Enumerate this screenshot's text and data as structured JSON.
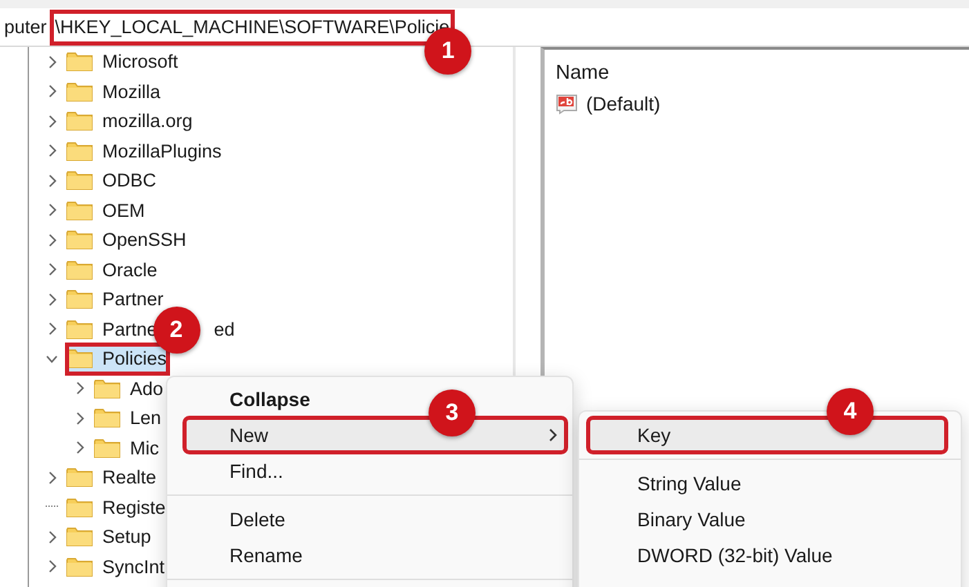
{
  "address_bar": {
    "segments": [
      {
        "text": "puter"
      },
      {
        "text": "\\HKEY_LOCAL_MACHINE\\SOFTWARE\\Policie",
        "step": "1"
      }
    ]
  },
  "tree": [
    {
      "label": "Microsoft",
      "has_children": true,
      "expanded": false,
      "selected": false
    },
    {
      "label": "Mozilla",
      "has_children": true,
      "expanded": false,
      "selected": false
    },
    {
      "label": "mozilla.org",
      "has_children": true,
      "expanded": false,
      "selected": false
    },
    {
      "label": "MozillaPlugins",
      "has_children": true,
      "expanded": false,
      "selected": false
    },
    {
      "label": "ODBC",
      "has_children": true,
      "expanded": false,
      "selected": false
    },
    {
      "label": "OEM",
      "has_children": true,
      "expanded": false,
      "selected": false
    },
    {
      "label": "OpenSSH",
      "has_children": true,
      "expanded": false,
      "selected": false
    },
    {
      "label": "Oracle",
      "has_children": true,
      "expanded": false,
      "selected": false
    },
    {
      "label": "Partner",
      "has_children": true,
      "expanded": false,
      "selected": false
    },
    {
      "label": "Partne",
      "label_tail": "ed",
      "has_children": true,
      "expanded": false,
      "selected": false
    },
    {
      "label": "Policies",
      "has_children": true,
      "expanded": true,
      "selected": true,
      "step": "2",
      "children": [
        {
          "label": "Ado",
          "has_children": true,
          "expanded": false,
          "selected": false
        },
        {
          "label": "Len",
          "has_children": true,
          "expanded": false,
          "selected": false
        },
        {
          "label": "Mic",
          "has_children": true,
          "expanded": false,
          "selected": false
        }
      ]
    },
    {
      "label": "Realte",
      "has_children": true,
      "expanded": false,
      "selected": false
    },
    {
      "label": "Registe",
      "has_children": false,
      "expanded": false,
      "selected": false
    },
    {
      "label": "Setup",
      "has_children": true,
      "expanded": false,
      "selected": false
    },
    {
      "label": "SyncInt",
      "has_children": true,
      "expanded": false,
      "selected": false
    }
  ],
  "values": {
    "columns": [
      "Name"
    ],
    "rows": [
      {
        "name": "(Default)"
      }
    ]
  },
  "context_menu": [
    {
      "kind": "item",
      "label": "Collapse",
      "bold": true,
      "highlighted": false
    },
    {
      "kind": "submenu",
      "label": "New",
      "bold": false,
      "highlighted": true,
      "step": "3"
    },
    {
      "kind": "item",
      "label": "Find...",
      "bold": false,
      "highlighted": false
    },
    {
      "kind": "separator"
    },
    {
      "kind": "item",
      "label": "Delete",
      "bold": false,
      "highlighted": false
    },
    {
      "kind": "item",
      "label": "Rename",
      "bold": false,
      "highlighted": false
    },
    {
      "kind": "separator"
    }
  ],
  "submenu": [
    {
      "kind": "item",
      "label": "Key",
      "bold": false,
      "highlighted": true,
      "step": "4"
    },
    {
      "kind": "separator"
    },
    {
      "kind": "item",
      "label": "String Value",
      "bold": false,
      "highlighted": false
    },
    {
      "kind": "item",
      "label": "Binary Value",
      "bold": false,
      "highlighted": false
    },
    {
      "kind": "item",
      "label": "DWORD (32-bit) Value",
      "bold": false,
      "highlighted": false
    }
  ]
}
